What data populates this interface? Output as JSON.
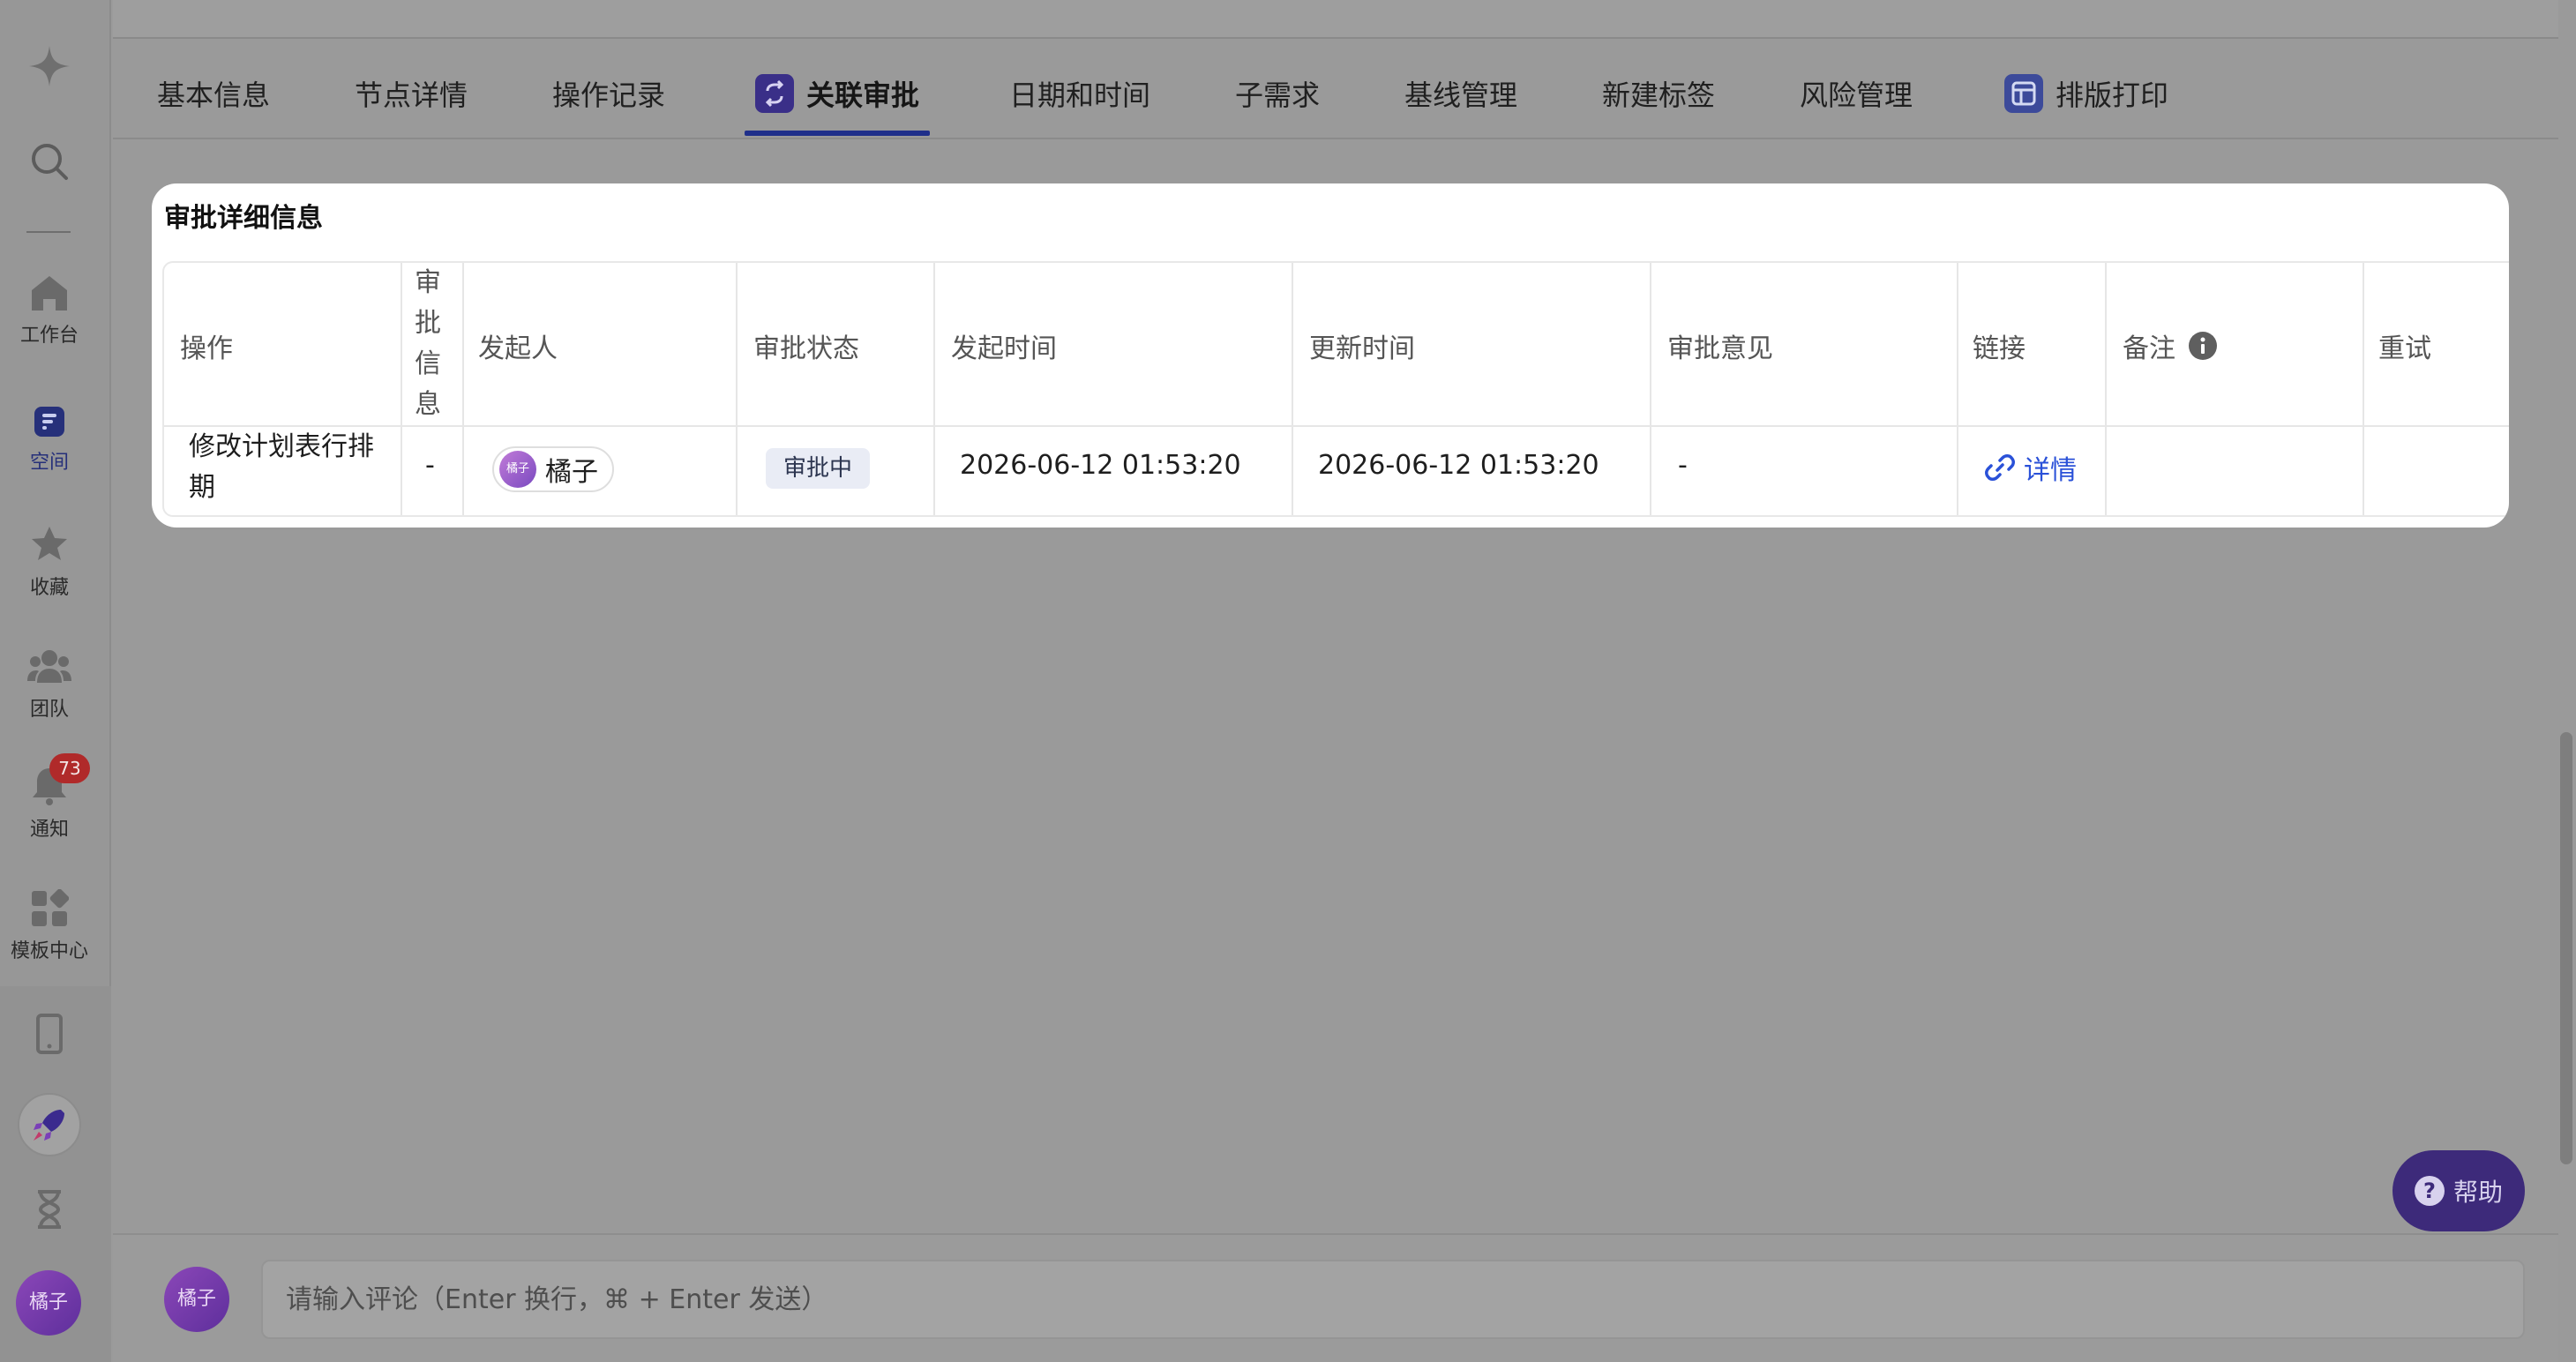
{
  "sidebar": {
    "items": [
      {
        "label": "工作台",
        "icon": "home-icon"
      },
      {
        "label": "空间",
        "icon": "space-icon"
      },
      {
        "label": "收藏",
        "icon": "star-icon"
      },
      {
        "label": "团队",
        "icon": "team-icon"
      },
      {
        "label": "通知",
        "icon": "bell-icon",
        "badge": "73"
      },
      {
        "label": "模板中心",
        "icon": "template-icon"
      }
    ],
    "user_avatar": "橘子"
  },
  "tabs": [
    {
      "label": "基本信息"
    },
    {
      "label": "节点详情"
    },
    {
      "label": "操作记录"
    },
    {
      "label": "关联审批",
      "active": true
    },
    {
      "label": "日期和时间"
    },
    {
      "label": "子需求"
    },
    {
      "label": "基线管理"
    },
    {
      "label": "新建标签"
    },
    {
      "label": "风险管理"
    },
    {
      "label": "排版打印"
    }
  ],
  "approval": {
    "title": "审批详细信息",
    "columns": [
      "操作",
      "审批信息",
      "发起人",
      "审批状态",
      "发起时间",
      "更新时间",
      "审批意见",
      "链接",
      "备注",
      "重试"
    ],
    "rows": [
      {
        "action": "修改计划表行排期",
        "info": "-",
        "initiator": "橘子",
        "initiator_avatar": "橘子",
        "status": "审批中",
        "start_time": "2026-06-12 01:53:20",
        "update_time": "2026-06-12 01:53:20",
        "opinion": "-",
        "link": "详情",
        "remark": "",
        "retry": ""
      }
    ]
  },
  "comment": {
    "avatar": "橘子",
    "placeholder": "请输入评论（Enter 换行，⌘ + Enter 发送）"
  },
  "help": {
    "label": "帮助"
  },
  "colors": {
    "accent": "#1f2f8a",
    "link": "#2a51d8",
    "badge": "#b02a2a"
  }
}
